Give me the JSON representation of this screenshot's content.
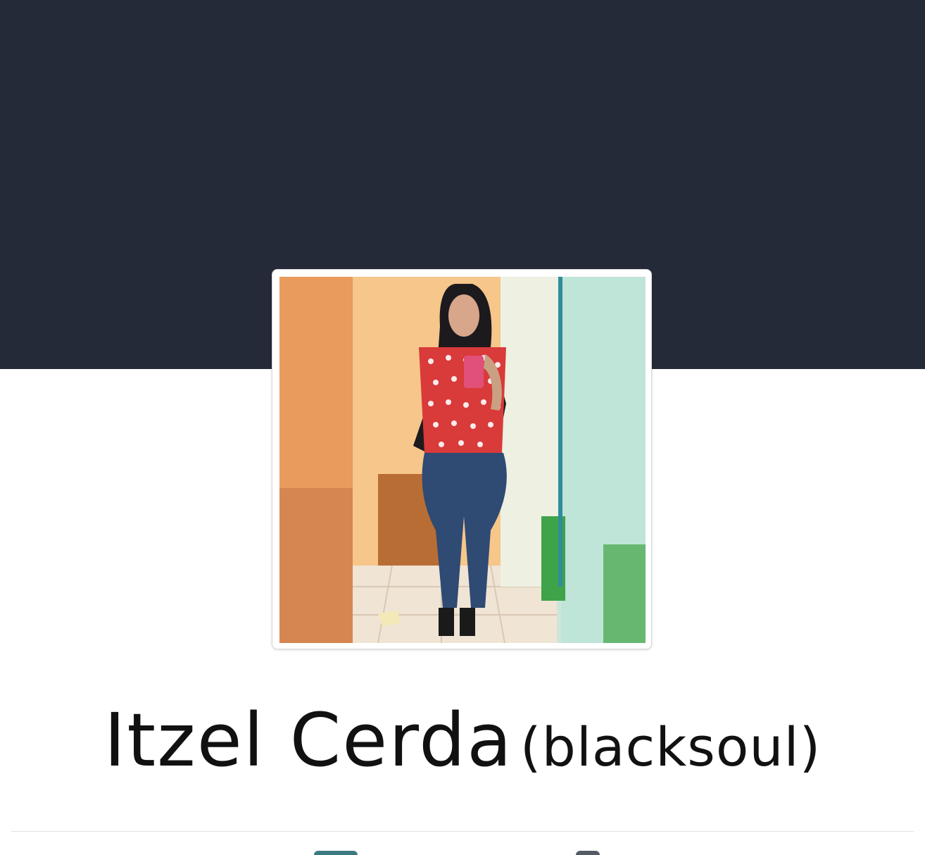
{
  "profile": {
    "name": "Itzel Cerda",
    "alternate_name": "(blacksoul)"
  },
  "colors": {
    "cover_background": "#252a38",
    "page_background": "#ffffff",
    "name_text": "#111111"
  },
  "icons": {
    "tab_peek_left": "tab-icon",
    "tab_peek_right": "tab-icon"
  }
}
